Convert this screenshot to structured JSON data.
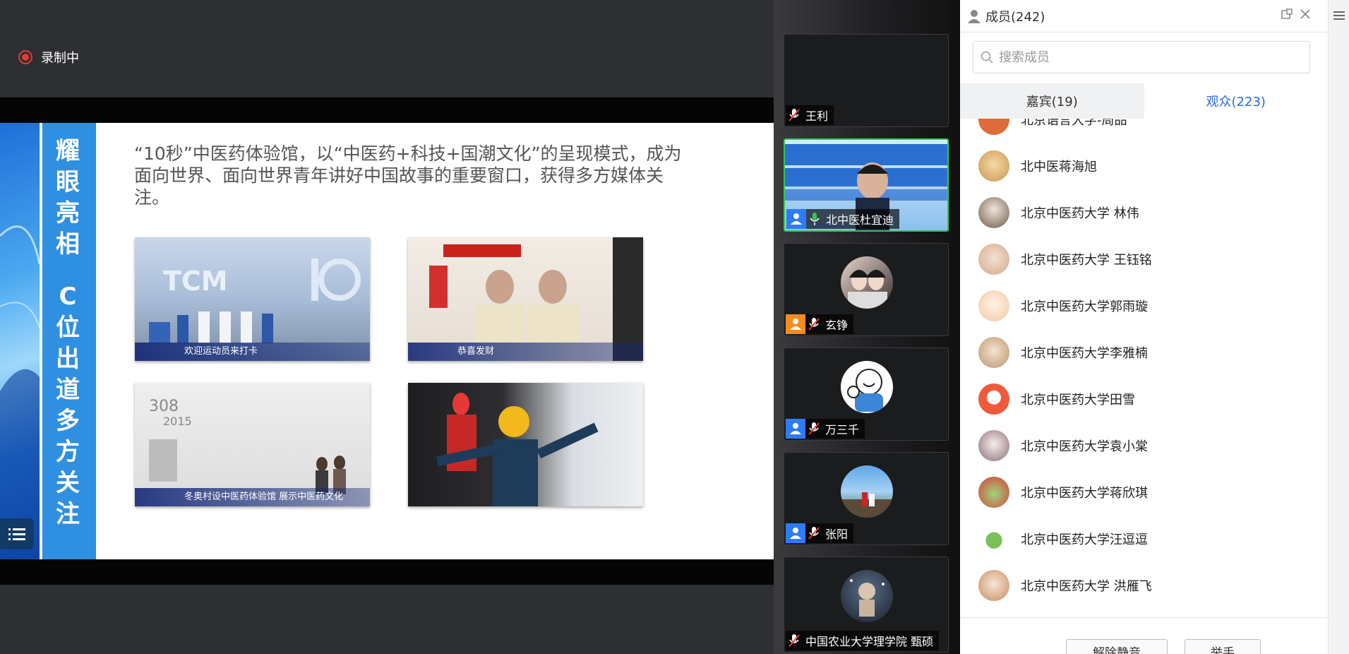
{
  "recording": {
    "label": "录制中"
  },
  "slide": {
    "vertical_title_1": [
      "耀",
      "眼",
      "亮",
      "相"
    ],
    "vertical_title_2": [
      "C",
      "位",
      "出",
      "道",
      "多",
      "方",
      "关",
      "注"
    ],
    "body_text": "“10秒”中医药体验馆，以“中医药+科技+国潮文化”的呈现模式，成为面向世界、面向世界青年讲好中国故事的重要窗口，获得多方媒体关注。",
    "photos": [
      {
        "caption": "欢迎运动员来打卡"
      },
      {
        "caption": "恭喜发财"
      },
      {
        "caption": "冬奥村设中医药体验馆 展示中医药文化"
      },
      {
        "caption": ""
      }
    ]
  },
  "tiles": [
    {
      "name": "王利",
      "role": "none",
      "muted": true
    },
    {
      "name": "北中医杜宜迪",
      "role": "blue",
      "muted": false,
      "active": true
    },
    {
      "name": "玄铮",
      "role": "orange",
      "muted": true
    },
    {
      "name": "万三千",
      "role": "blue",
      "muted": true
    },
    {
      "name": "张阳",
      "role": "blue",
      "muted": true
    },
    {
      "name": "中国农业大学理学院 甄硕",
      "role": "none",
      "muted": true
    }
  ],
  "panel": {
    "title": "成员(242)",
    "search_placeholder": "搜索成员",
    "tab_guests": "嘉宾(19)",
    "tab_audience": "观众(223)",
    "members": [
      "北京语言大学-周品",
      "北中医蒋海旭",
      "北京中医药大学 林伟",
      "北京中医药大学 王钰铭",
      "北京中医药大学郭雨璇",
      "北京中医药大学李雅楠",
      "北京中医药大学田雪",
      "北京中医药大学袁小棠",
      "北京中医药大学蒋欣琪",
      "北京中医药大学汪逗逗",
      "北京中医药大学 洪雁飞"
    ],
    "unmute_button": "解除静音",
    "raise_hand_button": "举手"
  },
  "colors": {
    "accent": "#2a6ad8",
    "record": "#e53935",
    "active_tile": "#34c759"
  }
}
